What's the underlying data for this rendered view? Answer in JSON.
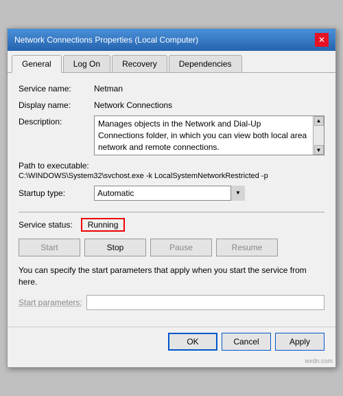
{
  "window": {
    "title": "Network Connections Properties (Local Computer)",
    "close_label": "✕"
  },
  "tabs": [
    {
      "id": "general",
      "label": "General",
      "active": true
    },
    {
      "id": "logon",
      "label": "Log On",
      "active": false
    },
    {
      "id": "recovery",
      "label": "Recovery",
      "active": false
    },
    {
      "id": "dependencies",
      "label": "Dependencies",
      "active": false
    }
  ],
  "fields": {
    "service_name_label": "Service name:",
    "service_name_value": "Netman",
    "display_name_label": "Display name:",
    "display_name_value": "Network Connections",
    "description_label": "Description:",
    "description_value": "Manages objects in the Network and Dial-Up Connections folder, in which you can view both local area network and remote connections.",
    "path_label": "Path to executable:",
    "path_value": "C:\\WINDOWS\\System32\\svchost.exe -k LocalSystemNetworkRestricted -p",
    "startup_label": "Startup type:",
    "startup_value": "Automatic"
  },
  "service_status": {
    "label": "Service status:",
    "value": "Running"
  },
  "buttons": {
    "start": "Start",
    "stop": "Stop",
    "pause": "Pause",
    "resume": "Resume"
  },
  "info_text": "You can specify the start parameters that apply when you start the service from here.",
  "params": {
    "label": "Start parameters:",
    "placeholder": ""
  },
  "footer": {
    "ok": "OK",
    "cancel": "Cancel",
    "apply": "Apply"
  },
  "watermark": "wxdn.com"
}
